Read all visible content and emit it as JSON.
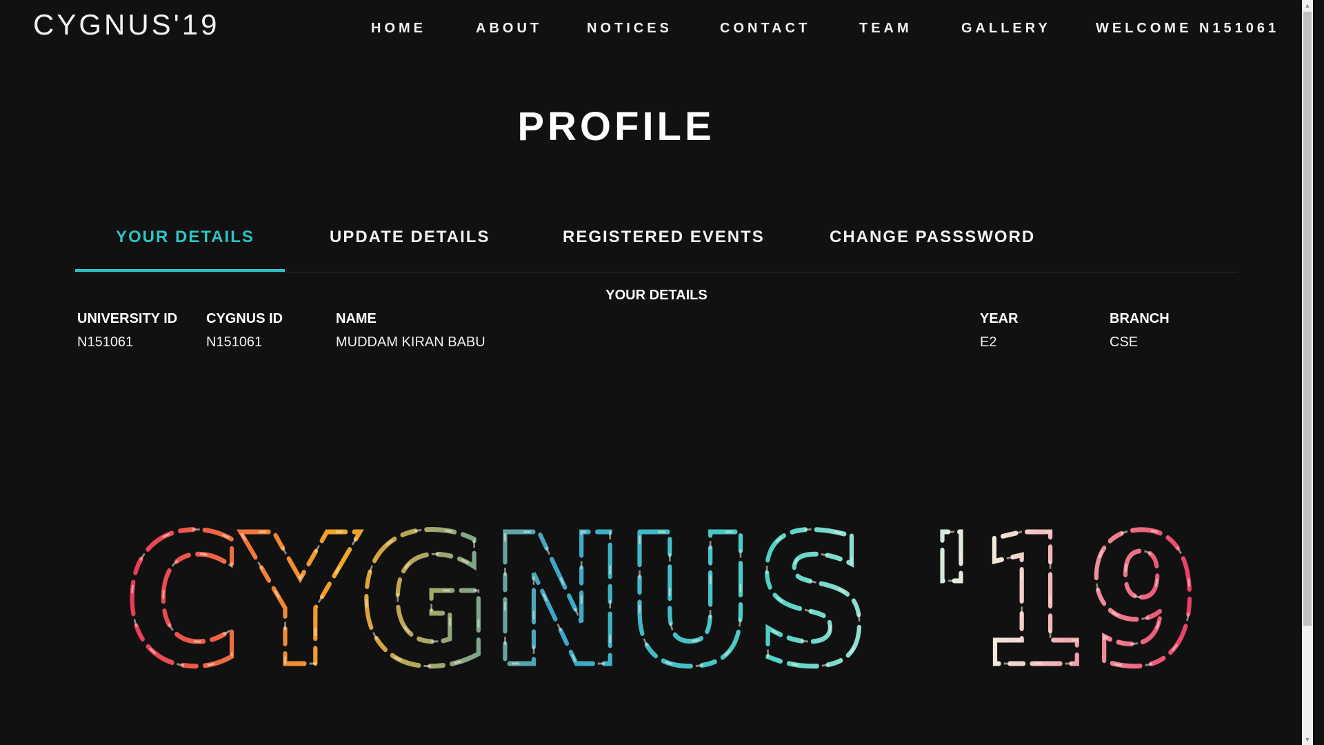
{
  "brand": "CYGNUS'19",
  "nav": {
    "items": [
      {
        "label": "HOME"
      },
      {
        "label": "ABOUT"
      },
      {
        "label": "NOTICES"
      },
      {
        "label": "CONTACT"
      },
      {
        "label": "TEAM"
      },
      {
        "label": "GALLERY"
      },
      {
        "label": "WELCOME N151061"
      }
    ]
  },
  "page_title": "PROFILE",
  "tabs": [
    {
      "label": "YOUR DETAILS",
      "active": true
    },
    {
      "label": "UPDATE DETAILS"
    },
    {
      "label": "REGISTERED EVENTS"
    },
    {
      "label": "CHANGE PASSSWORD"
    }
  ],
  "details": {
    "section_title": "YOUR DETAILS",
    "columns": [
      {
        "header": "UNIVERSITY ID",
        "value": "N151061"
      },
      {
        "header": "CYGNUS ID",
        "value": "N151061"
      },
      {
        "header": "NAME",
        "value": "MUDDAM KIRAN BABU"
      },
      {
        "header": "YEAR",
        "value": "E2"
      },
      {
        "header": "BRANCH",
        "value": "CSE"
      }
    ]
  },
  "logo_text": "CYGNUS '19",
  "colors": {
    "accent": "#2ec4c4",
    "background": "#111111",
    "logo_palette": [
      "#e8365d",
      "#f5a623",
      "#3aa6c6",
      "#4fd1c5",
      "#f3f0e0"
    ]
  }
}
